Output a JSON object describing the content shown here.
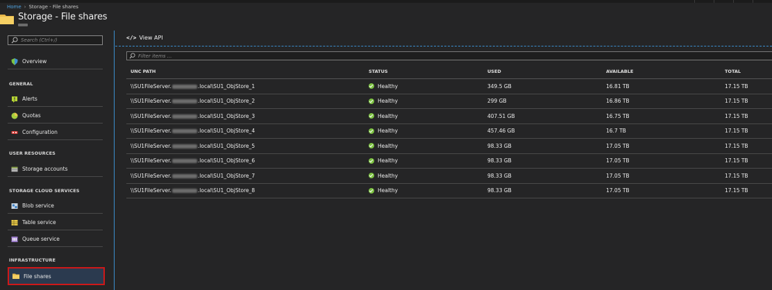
{
  "breadcrumb": {
    "home": "Home",
    "separator": "›",
    "current": "Storage - File shares"
  },
  "header": {
    "title": "Storage - File shares",
    "icon": "folder-icon"
  },
  "sidebar": {
    "search_placeholder": "Search (Ctrl+/)",
    "overview": {
      "label": "Overview",
      "icon": "shield-overview-icon"
    },
    "sections": [
      {
        "title": "GENERAL",
        "items": [
          {
            "label": "Alerts",
            "icon": "alert-icon"
          },
          {
            "label": "Quotas",
            "icon": "quota-icon"
          },
          {
            "label": "Configuration",
            "icon": "configuration-icon"
          }
        ]
      },
      {
        "title": "USER RESOURCES",
        "items": [
          {
            "label": "Storage accounts",
            "icon": "storage-account-icon"
          }
        ]
      },
      {
        "title": "STORAGE CLOUD SERVICES",
        "items": [
          {
            "label": "Blob service",
            "icon": "blob-icon"
          },
          {
            "label": "Table service",
            "icon": "table-icon"
          },
          {
            "label": "Queue service",
            "icon": "queue-icon"
          }
        ]
      },
      {
        "title": "INFRASTRUCTURE",
        "items": [
          {
            "label": "File shares",
            "icon": "folder-icon",
            "selected": true
          }
        ]
      }
    ]
  },
  "toolbar": {
    "view_api_label": "View API",
    "view_api_glyph": "</>"
  },
  "filter": {
    "placeholder": "Filter items ..."
  },
  "table": {
    "headers": [
      "UNC PATH",
      "STATUS",
      "USED",
      "AVAILABLE",
      "TOTAL"
    ],
    "rows": [
      {
        "path_prefix": "\\\\SU1FileServer.",
        "path_suffix": ".local\\SU1_ObjStore_1",
        "status": "Healthy",
        "used": "349.5 GB",
        "available": "16.81 TB",
        "total": "17.15 TB"
      },
      {
        "path_prefix": "\\\\SU1FileServer.",
        "path_suffix": ".local\\SU1_ObjStore_2",
        "status": "Healthy",
        "used": "299 GB",
        "available": "16.86 TB",
        "total": "17.15 TB"
      },
      {
        "path_prefix": "\\\\SU1FileServer.",
        "path_suffix": ".local\\SU1_ObjStore_3",
        "status": "Healthy",
        "used": "407.51 GB",
        "available": "16.75 TB",
        "total": "17.15 TB"
      },
      {
        "path_prefix": "\\\\SU1FileServer.",
        "path_suffix": ".local\\SU1_ObjStore_4",
        "status": "Healthy",
        "used": "457.46 GB",
        "available": "16.7 TB",
        "total": "17.15 TB"
      },
      {
        "path_prefix": "\\\\SU1FileServer.",
        "path_suffix": ".local\\SU1_ObjStore_5",
        "status": "Healthy",
        "used": "98.33 GB",
        "available": "17.05 TB",
        "total": "17.15 TB"
      },
      {
        "path_prefix": "\\\\SU1FileServer.",
        "path_suffix": ".local\\SU1_ObjStore_6",
        "status": "Healthy",
        "used": "98.33 GB",
        "available": "17.05 TB",
        "total": "17.15 TB"
      },
      {
        "path_prefix": "\\\\SU1FileServer.",
        "path_suffix": ".local\\SU1_ObjStore_7",
        "status": "Healthy",
        "used": "98.33 GB",
        "available": "17.05 TB",
        "total": "17.15 TB"
      },
      {
        "path_prefix": "\\\\SU1FileServer.",
        "path_suffix": ".local\\SU1_ObjStore_8",
        "status": "Healthy",
        "used": "98.33 GB",
        "available": "17.05 TB",
        "total": "17.15 TB"
      }
    ]
  },
  "colors": {
    "accent": "#3b8fd0",
    "healthy": "#7dc242",
    "selected_outline": "#d01818",
    "background": "#252526"
  }
}
